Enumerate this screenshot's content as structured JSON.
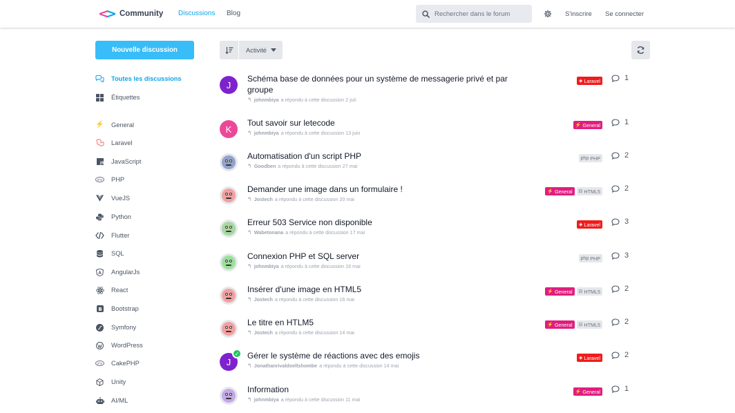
{
  "header": {
    "brand": "Community",
    "nav": [
      {
        "label": "Discussions",
        "active": true
      },
      {
        "label": "Blog",
        "active": false
      }
    ],
    "search_placeholder": "Rechercher dans le forum",
    "signup": "S'inscrire",
    "login": "Se connecter"
  },
  "sidebar": {
    "new_button": "Nouvelle discussion",
    "items": [
      {
        "label": "Toutes les discussions",
        "icon": "chat-bubbles-icon",
        "active": true
      },
      {
        "label": "Étiquettes",
        "icon": "grid-icon"
      },
      {
        "label": "General",
        "icon": "bolt-icon",
        "color": "#ec4899"
      },
      {
        "label": "Laravel",
        "icon": "laravel-icon",
        "color": "#f87171"
      },
      {
        "label": "JavaScript",
        "icon": "javascript-icon",
        "color": "#4b5563"
      },
      {
        "label": "PHP",
        "icon": "php-icon",
        "color": "#6b7280"
      },
      {
        "label": "VueJS",
        "icon": "vue-icon",
        "color": "#4b5563"
      },
      {
        "label": "Python",
        "icon": "python-icon",
        "color": "#4b5563"
      },
      {
        "label": "Flutter",
        "icon": "code-icon",
        "color": "#4b5563"
      },
      {
        "label": "SQL",
        "icon": "database-icon",
        "color": "#4b5563"
      },
      {
        "label": "AngularJs",
        "icon": "angular-icon",
        "color": "#4b5563"
      },
      {
        "label": "React",
        "icon": "react-icon",
        "color": "#4b5563"
      },
      {
        "label": "Bootstrap",
        "icon": "bootstrap-icon",
        "color": "#4b5563"
      },
      {
        "label": "Symfony",
        "icon": "symfony-icon",
        "color": "#4b5563"
      },
      {
        "label": "WordPress",
        "icon": "wordpress-icon",
        "color": "#4b5563"
      },
      {
        "label": "CakePHP",
        "icon": "cakephp-icon",
        "color": "#6b7280"
      },
      {
        "label": "Unity",
        "icon": "unity-icon",
        "color": "#4b5563"
      },
      {
        "label": "AI/ML",
        "icon": "robot-icon",
        "color": "#4b5563"
      }
    ]
  },
  "toolbar": {
    "activity": "Activité"
  },
  "tags": {
    "Laravel": {
      "bg": "#ef1c1c",
      "fg": "#ffffff",
      "icon": "laravel-icon"
    },
    "General": {
      "bg": "#e11d7e",
      "fg": "#ffffff",
      "icon": "bolt-icon"
    },
    "PHP": {
      "bg": "#e5e7eb",
      "fg": "#6b7280",
      "icon": "php-icon"
    },
    "HTML5": {
      "bg": "#e5e7eb",
      "fg": "#6b7280",
      "icon": "html5-icon"
    }
  },
  "discussions": [
    {
      "title": "Schéma base de données pour un système de messagerie privé et par groupe",
      "user": "johnmbiya",
      "action": "a répondu à cette discussion 2 juil.",
      "tags": [
        "Laravel"
      ],
      "replies": "1",
      "avatar": {
        "type": "letter",
        "letter": "J",
        "color": "#7e22ce"
      }
    },
    {
      "title": "Tout savoir sur letecode",
      "user": "johnmbiya",
      "action": "a répondu à cette discussion 13 juin",
      "tags": [
        "General"
      ],
      "replies": "1",
      "avatar": {
        "type": "letter",
        "letter": "K",
        "color": "#ec4899"
      }
    },
    {
      "title": "Automatisation d'un script PHP",
      "user": "Goodben",
      "action": "a répondu à cette discussion 27 mai",
      "tags": [
        "PHP"
      ],
      "replies": "2",
      "avatar": {
        "type": "face",
        "color": "#93a3c9"
      }
    },
    {
      "title": "Demander une image dans un formulaire !",
      "user": "Jostech",
      "action": "a répondu à cette discussion 20 mai",
      "tags": [
        "General",
        "HTML5"
      ],
      "replies": "2",
      "avatar": {
        "type": "face",
        "color": "#f4a0a0"
      }
    },
    {
      "title": "Erreur 503 Service non disponible",
      "user": "Wabetonana",
      "action": "a répondu à cette discussion 17 mai",
      "tags": [
        "Laravel"
      ],
      "replies": "3",
      "avatar": {
        "type": "face",
        "color": "#a7d8a0"
      }
    },
    {
      "title": "Connexion PHP et SQL server",
      "user": "johnmbiya",
      "action": "a répondu à cette discussion 16 mai",
      "tags": [
        "PHP"
      ],
      "replies": "3",
      "avatar": {
        "type": "face",
        "color": "#9be09b"
      }
    },
    {
      "title": "Insérer d'une image en HTML5",
      "user": "Jostech",
      "action": "a répondu à cette discussion 16 mai",
      "tags": [
        "General",
        "HTML5"
      ],
      "replies": "2",
      "avatar": {
        "type": "face",
        "color": "#f4a0a0"
      }
    },
    {
      "title": "Le titre en HTLM5",
      "user": "Jostech",
      "action": "a répondu à cette discussion 14 mai",
      "tags": [
        "General",
        "HTML5"
      ],
      "replies": "2",
      "avatar": {
        "type": "face",
        "color": "#f4a0a0"
      }
    },
    {
      "title": "Gérer le système de réactions avec des emojis",
      "user": "Jonathanrivaldoeltshombe",
      "action": "a répondu à cette discussion 14 mai",
      "tags": [
        "Laravel"
      ],
      "replies": "2",
      "avatar": {
        "type": "letter",
        "letter": "J",
        "color": "#7e22ce",
        "solved": true
      }
    },
    {
      "title": "Information",
      "user": "johnmbiya",
      "action": "a répondu à cette discussion 11 mai",
      "tags": [
        "General"
      ],
      "replies": "1",
      "avatar": {
        "type": "face",
        "color": "#c4a8e8"
      }
    }
  ]
}
